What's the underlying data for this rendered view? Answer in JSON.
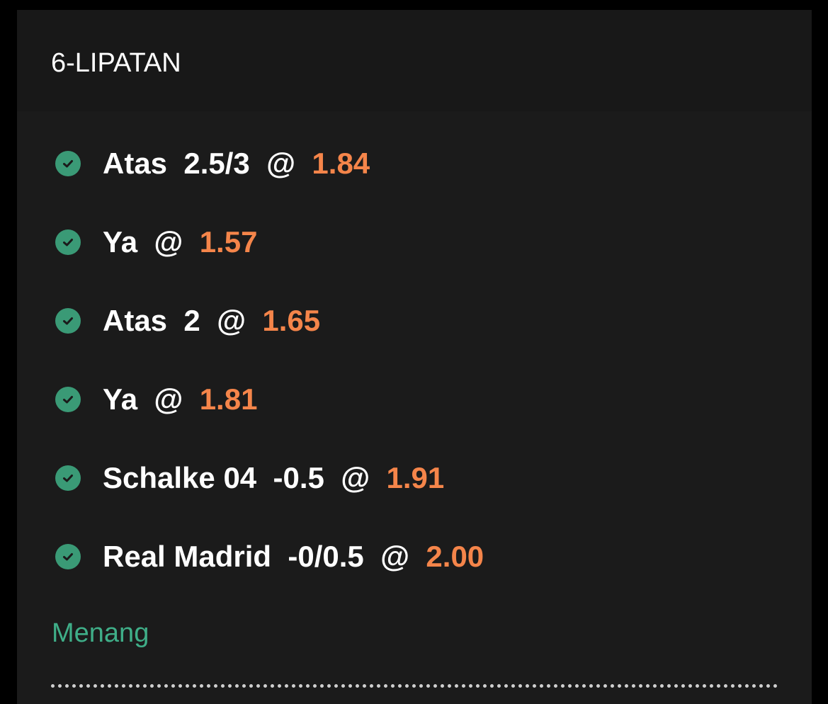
{
  "bet": {
    "title": "6-LIPATAN",
    "result": "Menang",
    "selections": [
      {
        "pick": "Atas  2.5/3  @  ",
        "odds": "1.84",
        "status": "won"
      },
      {
        "pick": "Ya  @  ",
        "odds": "1.57",
        "status": "won"
      },
      {
        "pick": "Atas  2  @  ",
        "odds": "1.65",
        "status": "won"
      },
      {
        "pick": "Ya  @  ",
        "odds": "1.81",
        "status": "won"
      },
      {
        "pick": "Schalke 04  -0.5  @  ",
        "odds": "1.91",
        "status": "won"
      },
      {
        "pick": "Real Madrid  -0/0.5  @  ",
        "odds": "2.00",
        "status": "won"
      }
    ]
  },
  "colors": {
    "background": "#1b1b1b",
    "header": "#181818",
    "odds": "#f5854a",
    "check": "#3a9a76",
    "result": "#3fae88"
  }
}
